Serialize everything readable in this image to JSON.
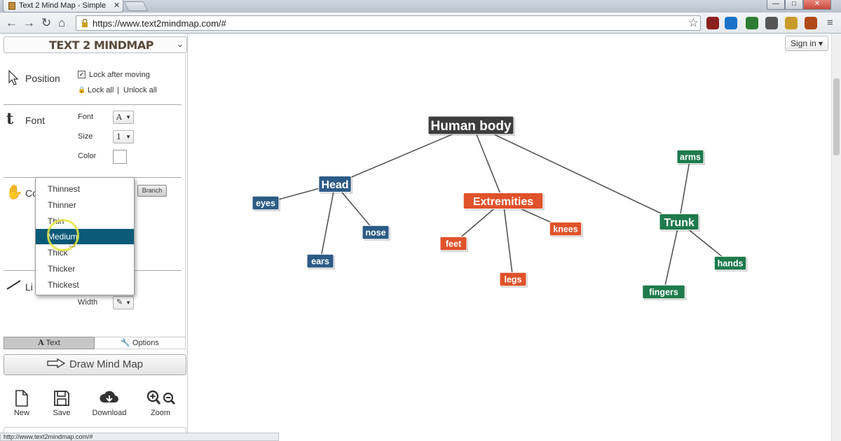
{
  "browser": {
    "tab_title": "Text 2 Mind Map - Simple",
    "tab_close": "✕",
    "url": "https://www.text2mindmap.com/#",
    "status_url": "http://www.text2mindmap.com/#",
    "win_min": "—",
    "win_max": "□",
    "win_close": "✕",
    "nav": {
      "back": "←",
      "forward": "→",
      "reload": "↻",
      "home": "⌂",
      "star": "☆",
      "menu": "≡"
    },
    "extension_colors": [
      "#8b2020",
      "#1a73c9",
      "#2e7d32",
      "#555555",
      "#c89b2a",
      "#b04a1a"
    ]
  },
  "logo": {
    "text": "TEXT 2 MINDMAP",
    "caret": "⌄"
  },
  "panel": {
    "position": {
      "title": "Position",
      "lock_after_moving": "Lock after moving",
      "lock_checked": true,
      "lock_all": "Lock all",
      "separator": "|",
      "unlock_all": "Unlock all"
    },
    "font": {
      "title": "Font",
      "font_label": "Font",
      "font_value": "A",
      "size_label": "Size",
      "size_value": "1",
      "color_label": "Color",
      "color_value": "#ffffff"
    },
    "color_section": {
      "title_partial": "Co",
      "branch_button": "Branch"
    },
    "line_section": {
      "title_partial": "Li",
      "width_label": "Width"
    },
    "width_menu": {
      "items": [
        "Thinnest",
        "Thinner",
        "Thin",
        "Medium",
        "Thick",
        "Thicker",
        "Thickest"
      ],
      "selected": "Medium"
    },
    "tabs": {
      "text": "Text",
      "options": "Options",
      "active": "Text"
    },
    "draw_button": "Draw Mind Map",
    "tools": [
      {
        "label": "New",
        "icon": "new-file-icon"
      },
      {
        "label": "Save",
        "icon": "save-icon"
      },
      {
        "label": "Download",
        "icon": "download-icon"
      },
      {
        "label": "Zoom",
        "icon": "zoom-icon"
      }
    ]
  },
  "header": {
    "sign_in": "Sign in"
  },
  "mindmap": {
    "colors": {
      "root": "#3d3d3d",
      "head": "#2c5b86",
      "extremities": "#e0522a",
      "trunk": "#1e7a4c",
      "line": "#555555"
    },
    "root": "Human body",
    "branches": [
      {
        "label": "Head",
        "children": [
          "eyes",
          "nose",
          "ears"
        ]
      },
      {
        "label": "Extremities",
        "children": [
          "feet",
          "knees",
          "legs"
        ]
      },
      {
        "label": "Trunk",
        "children": [
          "arms",
          "hands",
          "fingers"
        ]
      }
    ]
  }
}
